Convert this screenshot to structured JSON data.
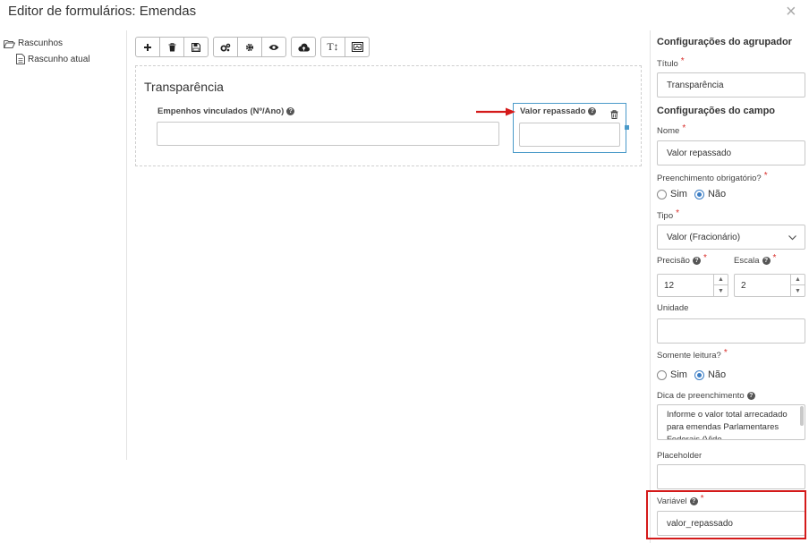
{
  "window": {
    "title": "Editor de formulários: Emendas",
    "close_glyph": "×"
  },
  "tree": {
    "root_label": "Rascunhos",
    "child_label": "Rascunho atual"
  },
  "toolbar": {
    "icons": [
      "plus-icon",
      "trash-icon",
      "save-icon",
      "cogs-icon",
      "gear-icon",
      "eye-icon",
      "cloud-upload-icon",
      "text-height-icon",
      "image-icon"
    ],
    "text_height_glyph": "T↕"
  },
  "form": {
    "group_title": "Transparência",
    "field1_label": "Empenhos vinculados (Nº/Ano)",
    "field1_value": "",
    "field2_label": "Valor repassado",
    "field2_value": ""
  },
  "panel": {
    "group_section_title": "Configurações do agrupador",
    "titulo_label": "Título",
    "titulo_value": "Transparência",
    "field_section_title": "Configurações do campo",
    "nome_label": "Nome",
    "nome_value": "Valor repassado",
    "obrigatorio_label": "Preenchimento obrigatório?",
    "obrigatorio_options": [
      "Sim",
      "Não"
    ],
    "obrigatorio_selected": "Não",
    "tipo_label": "Tipo",
    "tipo_value": "Valor (Fracionário)",
    "precisao_label": "Precisão",
    "precisao_value": "12",
    "escala_label": "Escala",
    "escala_value": "2",
    "unidade_label": "Unidade",
    "unidade_value": "",
    "leitura_label": "Somente leitura?",
    "leitura_options": [
      "Sim",
      "Não"
    ],
    "leitura_selected": "Não",
    "dica_label": "Dica de preenchimento",
    "dica_value": "Informe o valor total arrecadado para emendas Parlamentares Federais (Vide...",
    "placeholder_label": "Placeholder",
    "placeholder_value": "",
    "variavel_label": "Variável",
    "variavel_value": "valor_repassado",
    "required_mark": "*"
  },
  "colors": {
    "accent": "#3b7dc4",
    "required": "#d9302c",
    "highlight": "#d41a1a",
    "selection": "#4a9ac9"
  }
}
